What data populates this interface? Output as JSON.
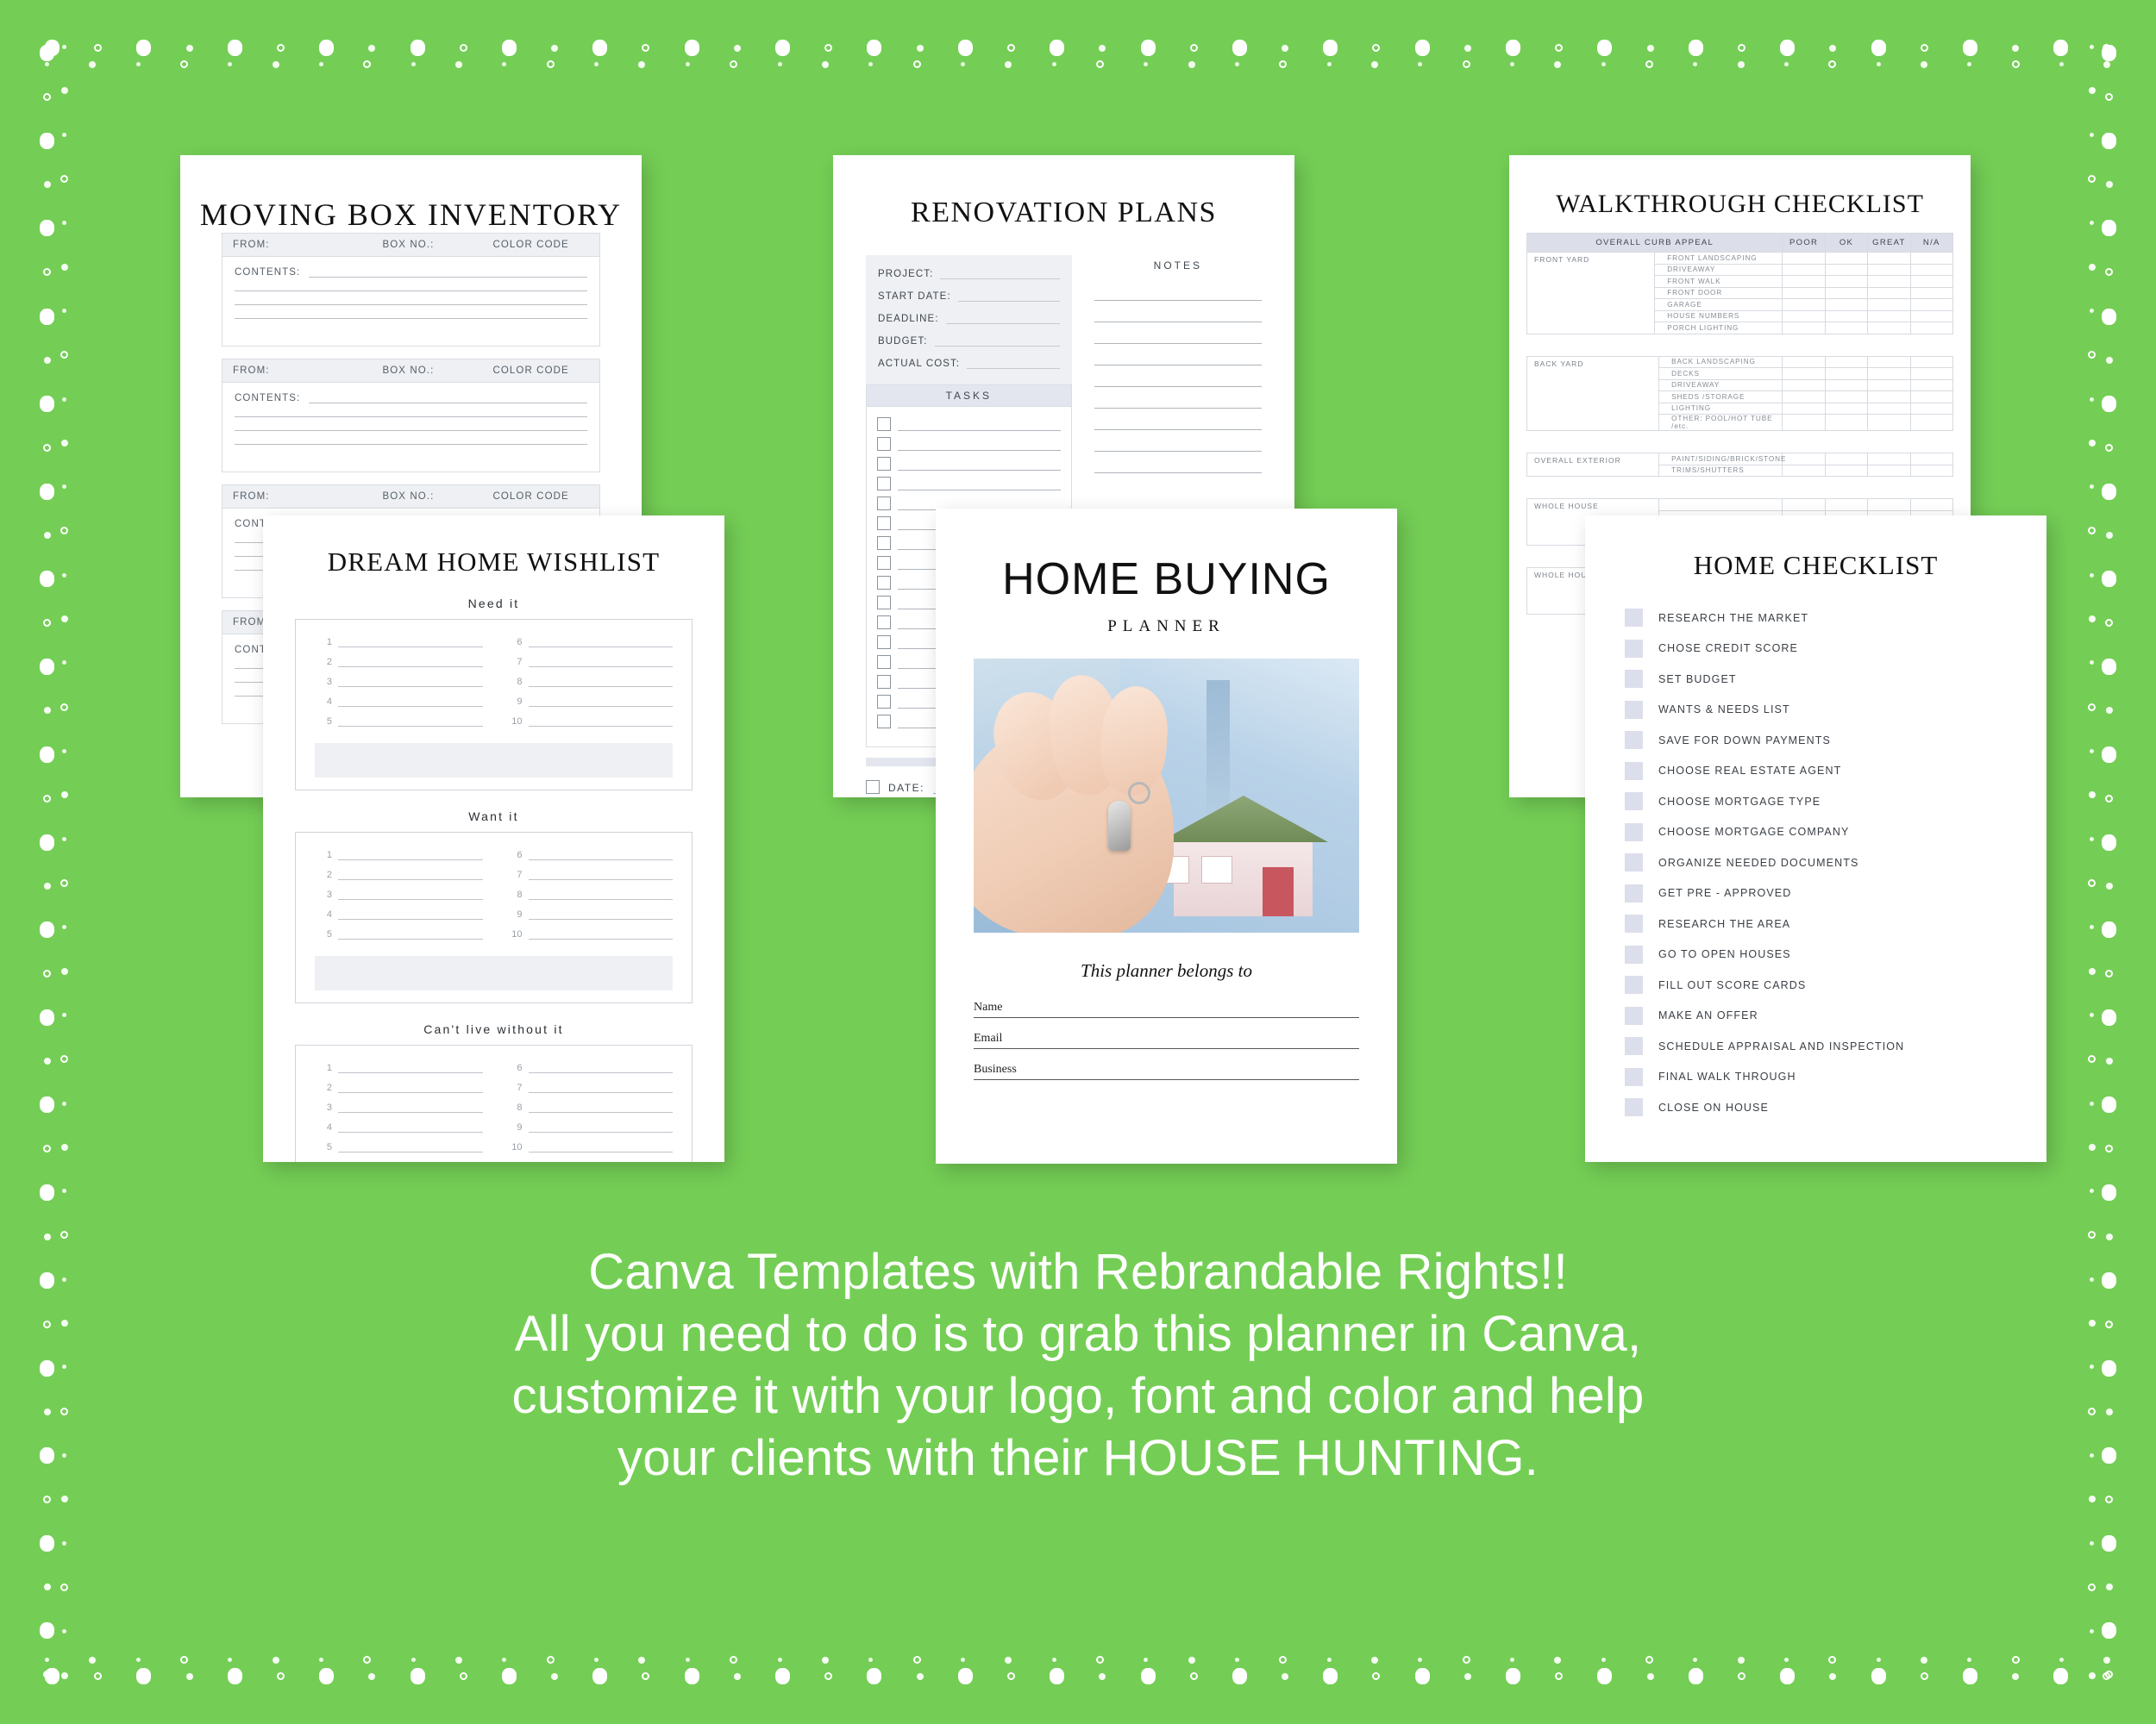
{
  "background": {
    "green": "#74ce55",
    "caption_color": "#ffffff"
  },
  "pages": {
    "moving_box": {
      "title": "MOVING BOX INVENTORY",
      "headers": [
        "FROM:",
        "BOX NO.:",
        "COLOR CODE"
      ],
      "contents_label": "CONTENTS:",
      "section_count": 4,
      "lines_per_section": 4
    },
    "renovation": {
      "title": "RENOVATION PLANS",
      "fields": [
        "PROJECT:",
        "START DATE:",
        "DEADLINE:",
        "BUDGET:",
        "ACTUAL COST:"
      ],
      "notes_label": "NOTES",
      "tasks_label": "TASKS",
      "task_rows": 16,
      "note_lines": 9,
      "date_label": "DATE:"
    },
    "walkthrough": {
      "title": "WALKTHROUGH CHECKLIST",
      "section_header": "OVERALL CURB APPEAL",
      "rating_columns": [
        "POOR",
        "OK",
        "GREAT",
        "N/A"
      ],
      "groups": [
        {
          "name": "FRONT YARD",
          "items": [
            "FRONT LANDSCAPING",
            "DRIVEAWAY",
            "FRONT WALK",
            "FRONT DOOR",
            "GARAGE",
            "HOUSE NUMBERS",
            "PORCH LIGHTING"
          ]
        },
        {
          "name": "BACK YARD",
          "items": [
            "BACK LANDSCAPING",
            "DECKS",
            "DRIVEAWAY",
            "SHEDS /STORAGE",
            "LIGHTING",
            "OTHER: POOL/HOT TUBE /etc."
          ]
        },
        {
          "name": "OVERALL EXTERIOR",
          "items": [
            "PAINT/SIDING/BRICK/STONE",
            "TRIMS/SHUTTERS"
          ]
        },
        {
          "name": "WHOLE HOUSE",
          "items": []
        },
        {
          "name": "WHOLE HOUSE",
          "items": []
        }
      ]
    },
    "wishlist": {
      "title": "DREAM HOME WISHLIST",
      "sections": [
        "Need it",
        "Want it",
        "Can't live without it"
      ],
      "numbers_left": [
        "1",
        "2",
        "3",
        "4",
        "5"
      ],
      "numbers_right": [
        "6",
        "7",
        "8",
        "9",
        "10"
      ]
    },
    "cover": {
      "title": "HOME BUYING",
      "subtitle": "PLANNER",
      "photo_alt": "hand holding house key with model house",
      "belongs_to": "This planner belongs to",
      "fields": [
        "Name",
        "Email",
        "Business"
      ]
    },
    "home_checklist": {
      "title": "HOME CHECKLIST",
      "items": [
        "RESEARCH THE MARKET",
        "CHOSE CREDIT SCORE",
        "SET BUDGET",
        "WANTS & NEEDS LIST",
        "SAVE FOR DOWN PAYMENTS",
        "CHOOSE REAL ESTATE AGENT",
        "CHOOSE MORTGAGE TYPE",
        "CHOOSE MORTGAGE COMPANY",
        "ORGANIZE NEEDED DOCUMENTS",
        "GET PRE - APPROVED",
        "RESEARCH THE AREA",
        "GO TO OPEN HOUSES",
        "FILL OUT SCORE CARDS",
        "MAKE AN OFFER",
        "SCHEDULE APPRAISAL AND INSPECTION",
        "FINAL WALK THROUGH",
        "CLOSE ON HOUSE"
      ]
    }
  },
  "caption": {
    "line1": "Canva Templates with Rebrandable Rights!!",
    "line2": "All you need to do is to grab this planner in Canva,",
    "line3": "customize it with your logo, font and color and help",
    "line4": "your clients with their HOUSE HUNTING."
  }
}
